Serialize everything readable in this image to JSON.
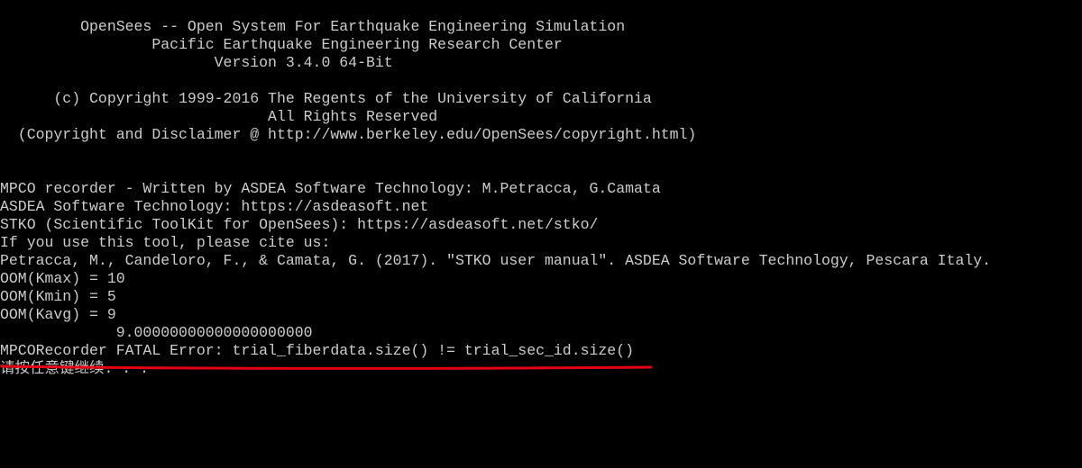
{
  "console": {
    "lines": [
      "         OpenSees -- Open System For Earthquake Engineering Simulation",
      "                 Pacific Earthquake Engineering Research Center",
      "                        Version 3.4.0 64-Bit",
      "",
      "      (c) Copyright 1999-2016 The Regents of the University of California",
      "                              All Rights Reserved",
      "  (Copyright and Disclaimer @ http://www.berkeley.edu/OpenSees/copyright.html)",
      "",
      "",
      "MPCO recorder - Written by ASDEA Software Technology: M.Petracca, G.Camata",
      "ASDEA Software Technology: https://asdeasoft.net",
      "STKO (Scientific ToolKit for OpenSees): https://asdeasoft.net/stko/",
      "If you use this tool, please cite us:",
      "Petracca, M., Candeloro, F., & Camata, G. (2017). \"STKO user manual\". ASDEA Software Technology, Pescara Italy.",
      "OOM(Kmax) = 10",
      "OOM(Kmin) = 5",
      "OOM(Kavg) = 9",
      "             9.00000000000000000000",
      "MPCORecorder FATAL Error: trial_fiberdata.size() != trial_sec_id.size()",
      "请按任意键继续. . ."
    ]
  },
  "colors": {
    "background": "#000000",
    "text": "#cccccc",
    "annotation": "#e60012"
  }
}
